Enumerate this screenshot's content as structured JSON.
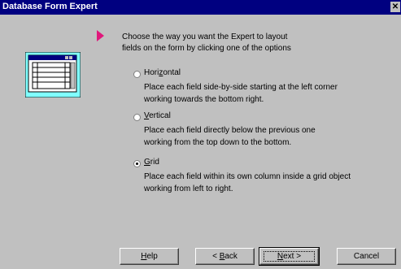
{
  "window": {
    "title": "Database Form Expert",
    "close_icon": "close-icon"
  },
  "instruction": {
    "line1": "Choose the way you want the Expert to layout",
    "line2": "fields on the form by clicking one of the options"
  },
  "layout_options": {
    "selected": "Grid",
    "items": [
      {
        "label_before": "Hori",
        "label_accel": "z",
        "label_after": "ontal",
        "desc1": "Place each field side-by-side starting at the left corner",
        "desc2": "working towards the bottom right.",
        "checked": false
      },
      {
        "label_before": "",
        "label_accel": "V",
        "label_after": "ertical",
        "desc1": "Place each field directly below the previous one",
        "desc2": "working from the top down to the bottom.",
        "checked": false
      },
      {
        "label_before": "",
        "label_accel": "G",
        "label_after": "rid",
        "desc1": "Place each field within its own column inside a grid object",
        "desc2": "working from left to right.",
        "checked": true
      }
    ]
  },
  "buttons": {
    "help": {
      "accel": "H",
      "rest": "elp"
    },
    "back": {
      "prefix": "< ",
      "accel": "B",
      "rest": "ack"
    },
    "next": {
      "accel": "N",
      "rest": "ext >"
    },
    "cancel": "Cancel"
  },
  "colors": {
    "titlebar": "#000080",
    "dialog": "#c0c0c0",
    "pointer": "#e0177b",
    "preview_bg": "#80ffff"
  }
}
